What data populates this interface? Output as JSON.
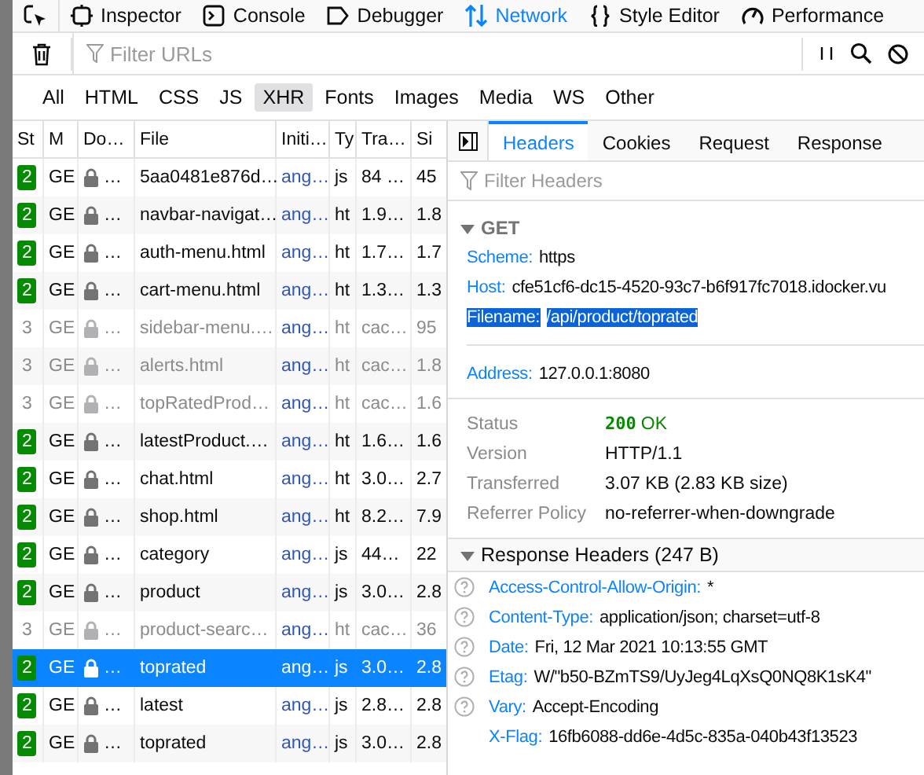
{
  "toolbox_tabs": [
    {
      "label": "Inspector",
      "selected": false
    },
    {
      "label": "Console",
      "selected": false
    },
    {
      "label": "Debugger",
      "selected": false
    },
    {
      "label": "Network",
      "selected": true
    },
    {
      "label": "Style Editor",
      "selected": false
    },
    {
      "label": "Performance",
      "selected": false
    }
  ],
  "filter": {
    "placeholder": "Filter URLs"
  },
  "type_filters": [
    {
      "label": "All",
      "selected": false
    },
    {
      "label": "HTML",
      "selected": false
    },
    {
      "label": "CSS",
      "selected": false
    },
    {
      "label": "JS",
      "selected": false
    },
    {
      "label": "XHR",
      "selected": true
    },
    {
      "label": "Fonts",
      "selected": false
    },
    {
      "label": "Images",
      "selected": false
    },
    {
      "label": "Media",
      "selected": false
    },
    {
      "label": "WS",
      "selected": false
    },
    {
      "label": "Other",
      "selected": false
    }
  ],
  "table": {
    "columns": [
      "St",
      "M",
      "Do…",
      "File",
      "Initi…",
      "Ty",
      "Tra…",
      "Si"
    ],
    "rows": [
      {
        "status": "2",
        "method": "GE",
        "domain": "…",
        "file": "5aa0481e876d…",
        "initiator": "ang…",
        "type": "js",
        "transferred": "84 …",
        "size": "45",
        "cached": false,
        "selected": false
      },
      {
        "status": "2",
        "method": "GE",
        "domain": "…",
        "file": "navbar-navigat…",
        "initiator": "ang…",
        "type": "ht",
        "transferred": "1.9…",
        "size": "1.8",
        "cached": false,
        "selected": false
      },
      {
        "status": "2",
        "method": "GE",
        "domain": "…",
        "file": "auth-menu.html",
        "initiator": "ang…",
        "type": "ht",
        "transferred": "1.7…",
        "size": "1.7",
        "cached": false,
        "selected": false
      },
      {
        "status": "2",
        "method": "GE",
        "domain": "…",
        "file": "cart-menu.html",
        "initiator": "ang…",
        "type": "ht",
        "transferred": "1.3…",
        "size": "1.3",
        "cached": false,
        "selected": false
      },
      {
        "status": "3",
        "method": "GE",
        "domain": "…",
        "file": "sidebar-menu.…",
        "initiator": "ang…",
        "type": "ht",
        "transferred": "cac…",
        "size": "95",
        "cached": true,
        "selected": false
      },
      {
        "status": "3",
        "method": "GE",
        "domain": "…",
        "file": "alerts.html",
        "initiator": "ang…",
        "type": "ht",
        "transferred": "cac…",
        "size": "1.8",
        "cached": true,
        "selected": false
      },
      {
        "status": "3",
        "method": "GE",
        "domain": "…",
        "file": "topRatedProd…",
        "initiator": "ang…",
        "type": "ht",
        "transferred": "cac…",
        "size": "1.6",
        "cached": true,
        "selected": false
      },
      {
        "status": "2",
        "method": "GE",
        "domain": "…",
        "file": "latestProduct.…",
        "initiator": "ang…",
        "type": "ht",
        "transferred": "1.6…",
        "size": "1.6",
        "cached": false,
        "selected": false
      },
      {
        "status": "2",
        "method": "GE",
        "domain": "…",
        "file": "chat.html",
        "initiator": "ang…",
        "type": "ht",
        "transferred": "3.0…",
        "size": "2.7",
        "cached": false,
        "selected": false
      },
      {
        "status": "2",
        "method": "GE",
        "domain": "…",
        "file": "shop.html",
        "initiator": "ang…",
        "type": "ht",
        "transferred": "8.2…",
        "size": "7.9",
        "cached": false,
        "selected": false
      },
      {
        "status": "2",
        "method": "GE",
        "domain": "…",
        "file": "category",
        "initiator": "ang…",
        "type": "js",
        "transferred": "44…",
        "size": "22",
        "cached": false,
        "selected": false
      },
      {
        "status": "2",
        "method": "GE",
        "domain": "…",
        "file": "product",
        "initiator": "ang…",
        "type": "js",
        "transferred": "3.0…",
        "size": "2.8",
        "cached": false,
        "selected": false
      },
      {
        "status": "3",
        "method": "GE",
        "domain": "…",
        "file": "product-searc…",
        "initiator": "ang…",
        "type": "ht",
        "transferred": "cac…",
        "size": "36",
        "cached": true,
        "selected": false
      },
      {
        "status": "2",
        "method": "GE",
        "domain": "…",
        "file": "toprated",
        "initiator": "ang…",
        "type": "js",
        "transferred": "3.0…",
        "size": "2.8",
        "cached": false,
        "selected": true
      },
      {
        "status": "2",
        "method": "GE",
        "domain": "…",
        "file": "latest",
        "initiator": "ang…",
        "type": "js",
        "transferred": "2.8…",
        "size": "2.8",
        "cached": false,
        "selected": false
      },
      {
        "status": "2",
        "method": "GE",
        "domain": "…",
        "file": "toprated",
        "initiator": "ang…",
        "type": "js",
        "transferred": "3.0…",
        "size": "2.8",
        "cached": false,
        "selected": false
      }
    ]
  },
  "details": {
    "tabs": [
      {
        "label": "Headers",
        "selected": true
      },
      {
        "label": "Cookies",
        "selected": false
      },
      {
        "label": "Request",
        "selected": false
      },
      {
        "label": "Response",
        "selected": false
      }
    ],
    "filter": {
      "placeholder": "Filter Headers"
    },
    "request": {
      "method": "GET",
      "expanded": true,
      "fields": [
        {
          "name": "Scheme:",
          "value": "https",
          "selected": false
        },
        {
          "name": "Host:",
          "value": "cfe51cf6-dc15-4520-93c7-b6f917fc7018.idocker.vu",
          "selected": false
        },
        {
          "name": "Filename:",
          "value": "/api/product/toprated",
          "selected": true
        }
      ],
      "address": {
        "name": "Address:",
        "value": "127.0.0.1:8080"
      }
    },
    "summary": [
      {
        "name": "Status",
        "kind": "status",
        "code": "200",
        "value": "OK"
      },
      {
        "name": "Version",
        "kind": "text",
        "value": "HTTP/1.1"
      },
      {
        "name": "Transferred",
        "kind": "text",
        "value": "3.07 KB (2.83 KB size)"
      },
      {
        "name": "Referrer Policy",
        "kind": "text",
        "value": "no-referrer-when-downgrade"
      }
    ],
    "response_headers": {
      "title": "Response Headers (247 B)",
      "expanded": true,
      "items": [
        {
          "name": "Access-Control-Allow-Origin:",
          "value": "*",
          "help": true
        },
        {
          "name": "Content-Type:",
          "value": "application/json; charset=utf-8",
          "help": true
        },
        {
          "name": "Date:",
          "value": "Fri, 12 Mar 2021 10:13:55 GMT",
          "help": true
        },
        {
          "name": "Etag:",
          "value": "W/\"b50-BZmTS9/UyJeg4LqXsQ0NQ8K1sK4\"",
          "help": true
        },
        {
          "name": "Vary:",
          "value": "Accept-Encoding",
          "help": true
        },
        {
          "name": "X-Flag:",
          "value": "16fb6088-dd6e-4d5c-835a-040b43f13523",
          "help": false
        }
      ]
    }
  }
}
